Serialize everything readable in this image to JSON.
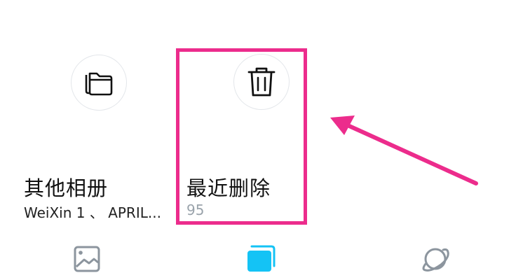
{
  "albums": [
    {
      "title": "其他相册",
      "subtitle": "WeiXin 1 、 APRIL...",
      "icon": "folder-icon"
    },
    {
      "title": "最近删除",
      "count": "95",
      "icon": "trash-icon"
    }
  ],
  "bottom_nav": [
    {
      "icon": "photo-icon",
      "active": false
    },
    {
      "icon": "albums-icon",
      "active": true
    },
    {
      "icon": "planet-icon",
      "active": false
    }
  ],
  "colors": {
    "highlight": "#ec2c8c",
    "active_nav": "#14c3f5",
    "inactive_nav": "#8c959e",
    "count_text": "#9aa3ab"
  }
}
